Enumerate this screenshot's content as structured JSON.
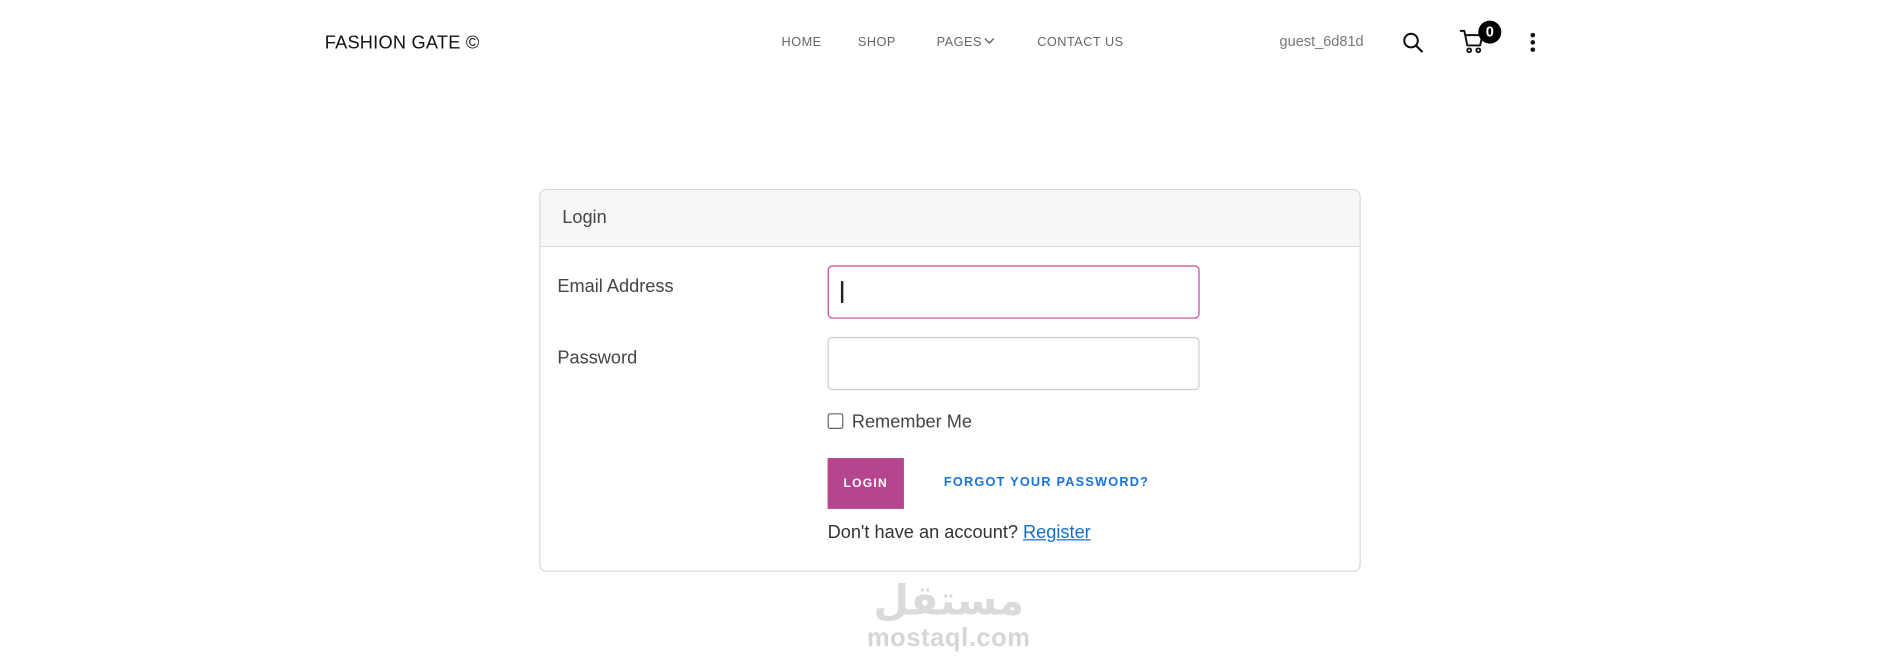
{
  "header": {
    "brand": "FASHION GATE ©",
    "nav": {
      "home": "HOME",
      "shop": "SHOP",
      "pages": "PAGES",
      "contact": "CONTACT US"
    },
    "username": "guest_6d81d",
    "cart_count": "0"
  },
  "login_card": {
    "title": "Login",
    "email_label": "Email Address",
    "email_value": "",
    "password_label": "Password",
    "password_value": "",
    "remember_label": "Remember Me",
    "login_button": "LOGIN",
    "forgot_link": "FORGOT YOUR PASSWORD?",
    "no_account_text": "Don't have an account? ",
    "register_link": "Register"
  },
  "watermark": {
    "arabic": "مستقل",
    "latin": "mostaql.com"
  },
  "colors": {
    "accent": "#b5458f",
    "link": "#1a73d9",
    "focus_border": "#c2449a"
  },
  "icons": {
    "search": "search-icon",
    "cart": "cart-icon",
    "more": "more-vertical-icon",
    "pages_dropdown": "chevron-down-icon"
  }
}
